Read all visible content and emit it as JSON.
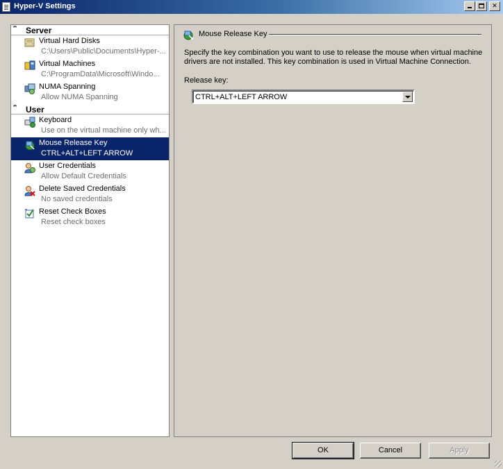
{
  "window": {
    "title": "Hyper-V Settings"
  },
  "nav": {
    "server": {
      "label": "Server",
      "items": [
        {
          "name": "Virtual Hard Disks",
          "sub": "C:\\Users\\Public\\Documents\\Hyper-...",
          "icon": "virtual-hard-disks-icon"
        },
        {
          "name": "Virtual Machines",
          "sub": "C:\\ProgramData\\Microsoft\\Windo...",
          "icon": "virtual-machines-icon"
        },
        {
          "name": "NUMA Spanning",
          "sub": "Allow NUMA Spanning",
          "icon": "numa-spanning-icon"
        }
      ]
    },
    "user": {
      "label": "User",
      "items": [
        {
          "name": "Keyboard",
          "sub": "Use on the virtual machine only wh...",
          "icon": "keyboard-icon"
        },
        {
          "name": "Mouse Release Key",
          "sub": "CTRL+ALT+LEFT ARROW",
          "icon": "mouse-release-key-icon",
          "selected": true
        },
        {
          "name": "User Credentials",
          "sub": "Allow Default Credentials",
          "icon": "user-credentials-icon"
        },
        {
          "name": "Delete Saved Credentials",
          "sub": "No saved credentials",
          "icon": "delete-saved-credentials-icon"
        },
        {
          "name": "Reset Check Boxes",
          "sub": "Reset check boxes",
          "icon": "reset-check-boxes-icon"
        }
      ]
    }
  },
  "content": {
    "section_title": "Mouse Release Key",
    "description": "Specify the key combination you want to use to release the mouse when virtual machine drivers are not installed. This key combination is used in Virtual Machine Connection.",
    "release_key_label": "Release key:",
    "release_key_value": "CTRL+ALT+LEFT ARROW"
  },
  "buttons": {
    "ok": "OK",
    "cancel": "Cancel",
    "apply": "Apply"
  },
  "colors": {
    "selection": "#0a246a",
    "titlebar": "#0a246a",
    "window_bg": "#d4d0c8"
  }
}
